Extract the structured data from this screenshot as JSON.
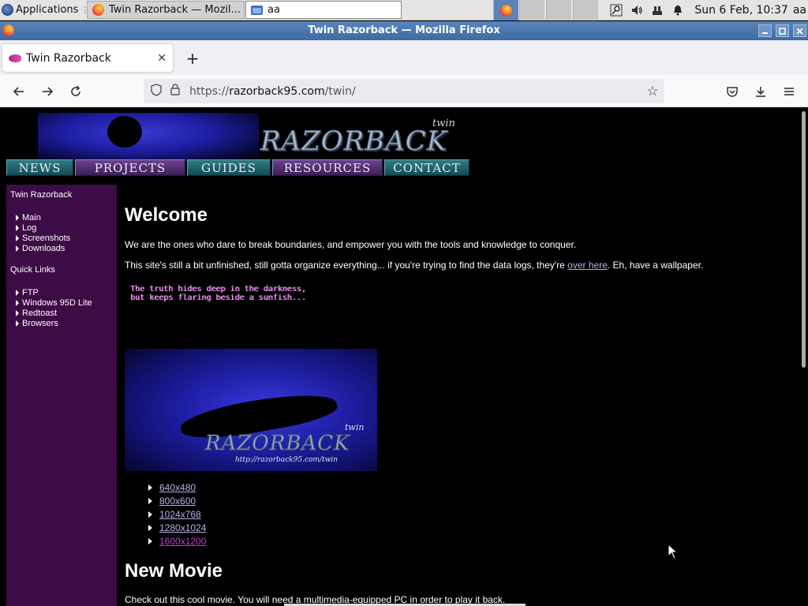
{
  "panel": {
    "apps_label": "Applications",
    "apps_sep": "⋮",
    "task1_label": "Twin Razorback — Mozil...",
    "task2_label": "aa",
    "clock": "Sun  6 Feb, 10:37",
    "user": "aa"
  },
  "window": {
    "title": "Twin Razorback — Mozilla Firefox"
  },
  "browser": {
    "tab_title": "Twin Razorback",
    "url_scheme": "https://",
    "url_host": "razorback95.com",
    "url_path": "/twin/"
  },
  "banner": {
    "word": "RAZORBACK",
    "twin": "twin"
  },
  "topnav": [
    {
      "label": "NEWS"
    },
    {
      "label": "PROJECTS"
    },
    {
      "label": "GUIDES"
    },
    {
      "label": "RESOURCES"
    },
    {
      "label": "CONTACT"
    }
  ],
  "sidebar": {
    "section1": "Twin Razorback",
    "links1": [
      {
        "label": "Main"
      },
      {
        "label": "Log"
      },
      {
        "label": "Screenshots"
      },
      {
        "label": "Downloads"
      }
    ],
    "section2": "Quick Links",
    "links2": [
      {
        "label": "FTP"
      },
      {
        "label": "Windows 95D Lite"
      },
      {
        "label": "Redtoast"
      },
      {
        "label": "Browsers"
      }
    ]
  },
  "content": {
    "welcome_heading": "Welcome",
    "intro": "We are the ones who dare to break boundaries, and empower you with the tools and knowledge to conquer.",
    "p2_before": "This site's still a bit unfinished, still gotta organize everything... if you're trying to find the data logs, they're ",
    "p2_link": "over here",
    "p2_after": ". Eh, have a wallpaper.",
    "wallpaper": {
      "quote": "The truth hides deep in the darkness,\nbut keeps flaring beside a sunfish...",
      "logo": "RAZORBACK",
      "twin": "twin",
      "url": "http://razorback95.com/twin"
    },
    "resolutions": [
      {
        "label": "640x480",
        "visited": false
      },
      {
        "label": "800x600",
        "visited": false
      },
      {
        "label": "1024x768",
        "visited": false
      },
      {
        "label": "1280x1024",
        "visited": false
      },
      {
        "label": "1600x1200",
        "visited": true
      }
    ],
    "movie_heading": "New Movie",
    "movie_text": "Check out this cool movie. You will need a multimedia-equipped PC in order to play it back."
  }
}
